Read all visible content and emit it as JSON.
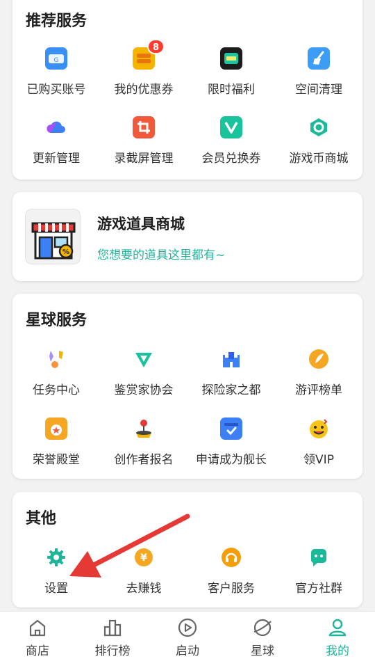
{
  "recommended": {
    "title": "推荐服务",
    "items": [
      {
        "label": "已购买账号",
        "icon": "account-icon"
      },
      {
        "label": "我的优惠券",
        "icon": "coupon-icon",
        "badge": "8"
      },
      {
        "label": "限时福利",
        "icon": "welfare-icon"
      },
      {
        "label": "空间清理",
        "icon": "broom-icon"
      },
      {
        "label": "更新管理",
        "icon": "cloud-icon"
      },
      {
        "label": "录截屏管理",
        "icon": "crop-icon"
      },
      {
        "label": "会员兑换券",
        "icon": "vip-voucher-icon"
      },
      {
        "label": "游戏币商城",
        "icon": "coin-icon"
      }
    ]
  },
  "shop_banner": {
    "title": "游戏道具商城",
    "subtitle": "您想要的道具这里都有~",
    "icon": "store-icon"
  },
  "planet": {
    "title": "星球服务",
    "items": [
      {
        "label": "任务中心",
        "icon": "task-icon"
      },
      {
        "label": "鉴赏家协会",
        "icon": "connoisseur-icon"
      },
      {
        "label": "探险家之都",
        "icon": "castle-icon"
      },
      {
        "label": "游评榜单",
        "icon": "quill-icon"
      },
      {
        "label": "荣誉殿堂",
        "icon": "medal-icon"
      },
      {
        "label": "创作者报名",
        "icon": "joystick-icon"
      },
      {
        "label": "申请成为舰长",
        "icon": "check-window-icon"
      },
      {
        "label": "领VIP",
        "icon": "emoji-icon"
      }
    ]
  },
  "other": {
    "title": "其他",
    "items": [
      {
        "label": "设置",
        "icon": "gear-icon"
      },
      {
        "label": "去赚钱",
        "icon": "yuan-coin-icon"
      },
      {
        "label": "客户服务",
        "icon": "headset-icon"
      },
      {
        "label": "官方社群",
        "icon": "chat-icon"
      }
    ]
  },
  "tabs": [
    {
      "label": "商店",
      "icon": "home-icon"
    },
    {
      "label": "排行榜",
      "icon": "ranking-icon"
    },
    {
      "label": "启动",
      "icon": "play-icon"
    },
    {
      "label": "星球",
      "icon": "planet-icon"
    },
    {
      "label": "我的",
      "icon": "user-icon",
      "active": true
    }
  ],
  "colors": {
    "accent": "#1fb59b",
    "badge": "#ff3b30",
    "arrow": "#e53935",
    "subtitle": "#21b39a"
  }
}
